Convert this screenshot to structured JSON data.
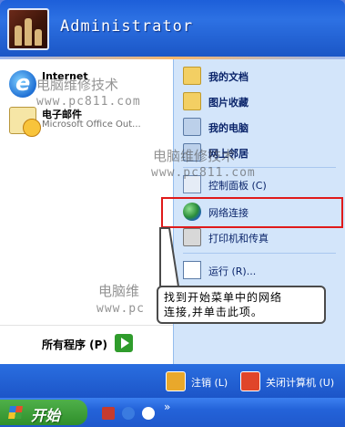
{
  "user": {
    "name": "Administrator"
  },
  "pinned": [
    {
      "title": "Internet",
      "subtitle": "",
      "icon": "internet-explorer-icon"
    },
    {
      "title": "电子邮件",
      "subtitle": "Microsoft Office Out...",
      "icon": "email-icon"
    }
  ],
  "all_programs": "所有程序 (P)",
  "places": [
    {
      "label": "我的文档",
      "icon": "folder-icon"
    },
    {
      "label": "图片收藏",
      "icon": "pictures-folder-icon"
    },
    {
      "label": "我的电脑",
      "icon": "computer-icon"
    },
    {
      "label": "网上邻居",
      "icon": "network-places-icon"
    },
    {
      "label": "控制面板 (C)",
      "icon": "control-panel-icon"
    },
    {
      "label": "网络连接",
      "icon": "network-connections-icon"
    },
    {
      "label": "打印机和传真",
      "icon": "printer-icon"
    },
    {
      "label": "运行 (R)...",
      "icon": "run-icon"
    }
  ],
  "footer": {
    "logoff": "注销 (L)",
    "shutdown": "关闭计算机 (U)"
  },
  "taskbar": {
    "start": "开始",
    "more": "»"
  },
  "callout": {
    "line1": "找到开始菜单中的网络",
    "line2": "连接,并单击此项。"
  },
  "watermarks": {
    "brand": "电脑维修技术",
    "url": "www.pc811.com",
    "brand_partial": "电脑维",
    "url_partial": "www.pc"
  },
  "colors": {
    "highlight": "#e01a1a",
    "menu_blue": "#1d5fd9",
    "right_panel": "#d3e5fa"
  }
}
